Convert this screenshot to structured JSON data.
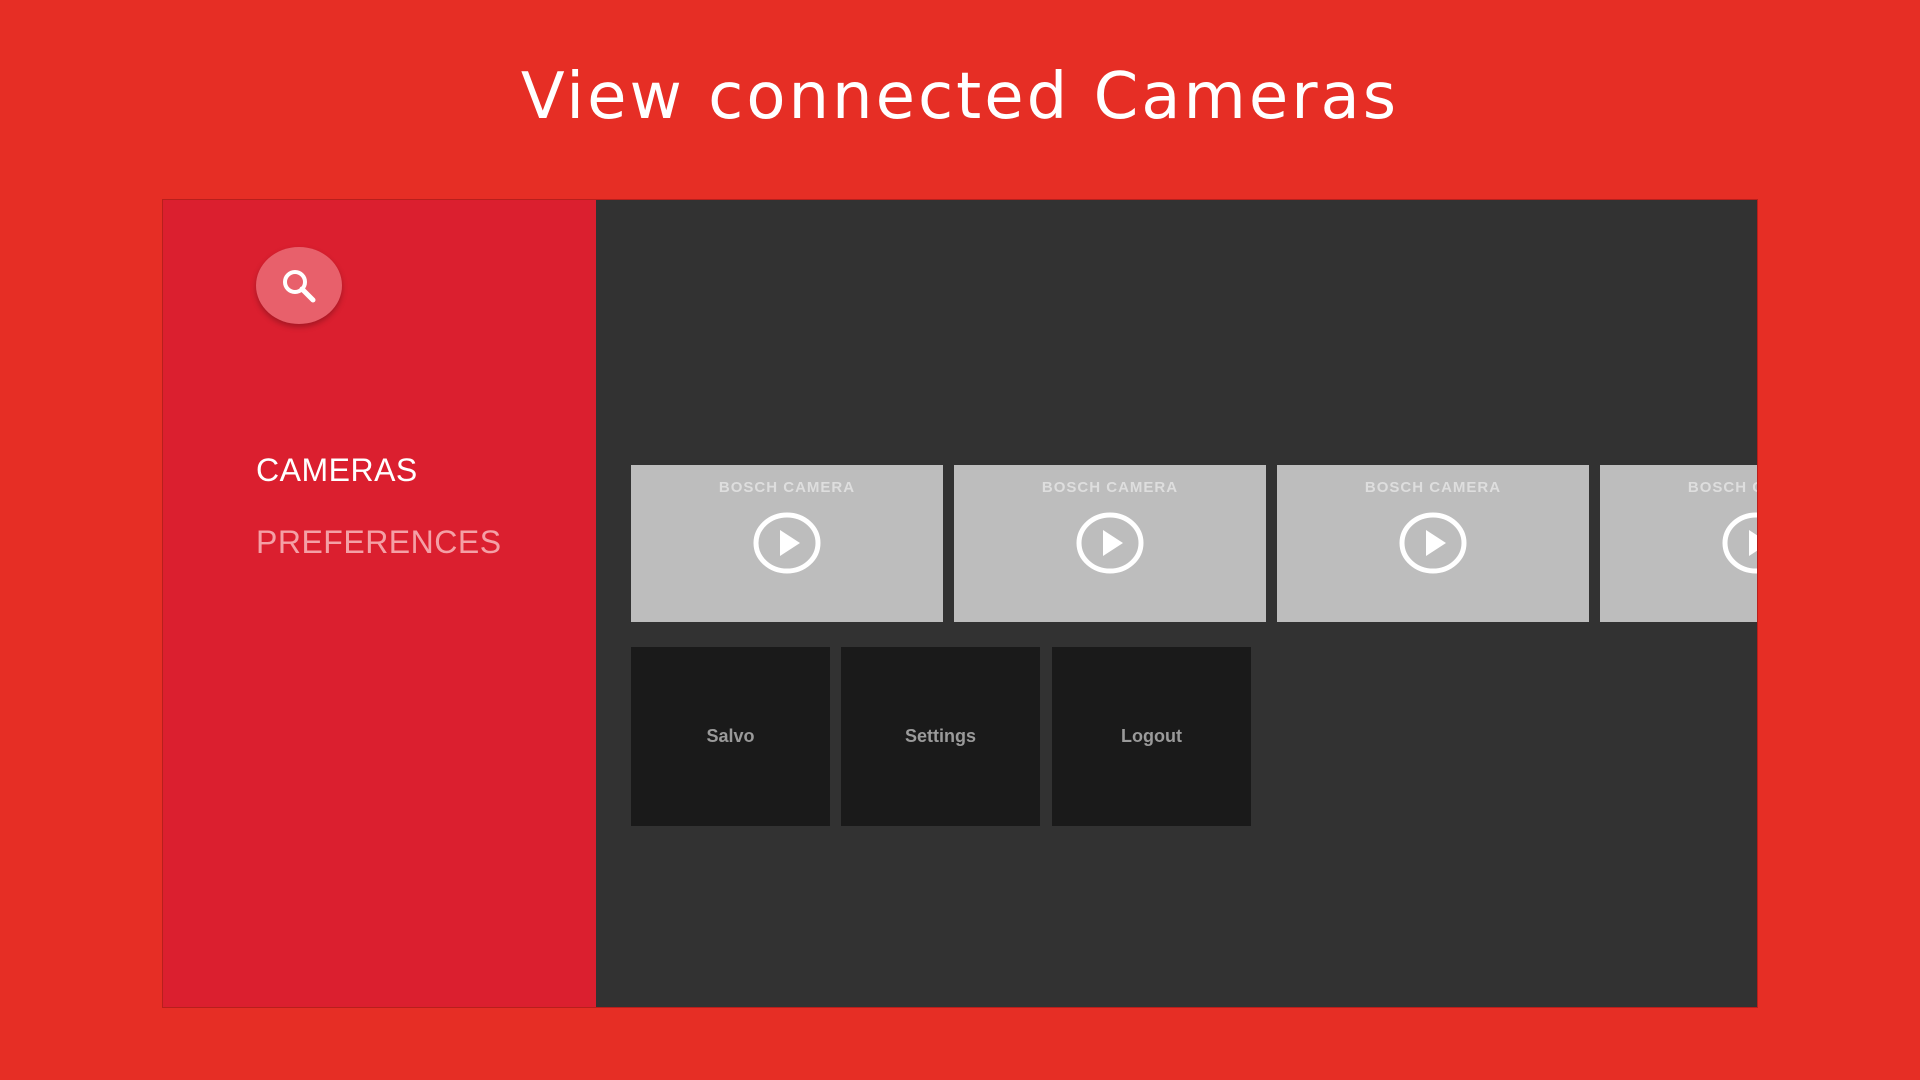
{
  "headline": "View connected Cameras",
  "colors": {
    "background": "#e62e25",
    "sidebar": "#db1f2f",
    "content": "#323232",
    "search_button": "#e8606b",
    "card": "#bdbdbd",
    "action_tile": "#1a1a1a"
  },
  "sidebar": {
    "search_icon": "search-icon",
    "items": [
      {
        "label": "CAMERAS",
        "selected": true
      },
      {
        "label": "PREFERENCES",
        "selected": false
      }
    ]
  },
  "cameras": {
    "cards": [
      {
        "title": "BOSCH CAMERA",
        "icon": "play-circle-icon"
      },
      {
        "title": "BOSCH CAMERA",
        "icon": "play-circle-icon"
      },
      {
        "title": "BOSCH CAMERA",
        "icon": "play-circle-icon"
      },
      {
        "title": "BOSCH CAMERA",
        "icon": "play-circle-icon"
      }
    ]
  },
  "actions": [
    {
      "label": "Salvo"
    },
    {
      "label": "Settings"
    },
    {
      "label": "Logout"
    }
  ]
}
